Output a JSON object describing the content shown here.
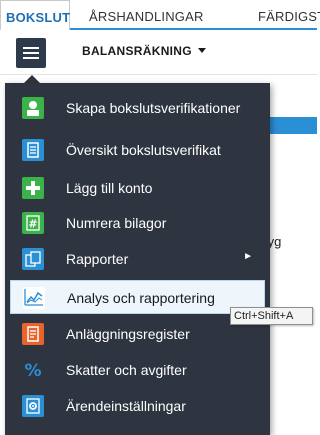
{
  "tabs": [
    {
      "label": "BOKSLUT",
      "active": true
    },
    {
      "label": "ÅRSHANDLINGAR",
      "active": false
    },
    {
      "label": "FÄRDIGST",
      "active": false
    }
  ],
  "toolbar": {
    "menu_icon": "hamburger-icon",
    "subtab_label": "BALANSRÄKNING"
  },
  "background": {
    "partial_text": "tyg"
  },
  "menu": {
    "items": [
      {
        "label": "Skapa bokslutsverifikationer",
        "icon": "person-icon",
        "icon_color": "#3bb34a"
      },
      {
        "label": "Översikt bokslutsverifikat",
        "icon": "document-list-icon",
        "icon_color": "#2b8fd6"
      },
      {
        "label": "Lägg till konto",
        "icon": "plus-icon",
        "icon_color": "#3bb34a"
      },
      {
        "label": "Numrera bilagor",
        "icon": "hash-icon",
        "icon_color": "#3bb34a"
      },
      {
        "label": "Rapporter",
        "icon": "copy-documents-icon",
        "icon_color": "#2b8fd6",
        "submenu_arrow": "►"
      },
      {
        "label": "Analys och rapportering",
        "icon": "line-chart-icon",
        "icon_color": "#2b8fd6",
        "highlighted": true
      },
      {
        "label": "Anläggningsregister",
        "icon": "register-document-icon",
        "icon_color": "#e8642c"
      },
      {
        "label": "Skatter och avgifter",
        "icon": "percent-icon",
        "icon_color": "#2b8fd6"
      },
      {
        "label": "Ärendeinställningar",
        "icon": "settings-document-icon",
        "icon_color": "#2b8fd6"
      }
    ]
  },
  "tooltip": {
    "text": "Ctrl+Shift+A"
  }
}
